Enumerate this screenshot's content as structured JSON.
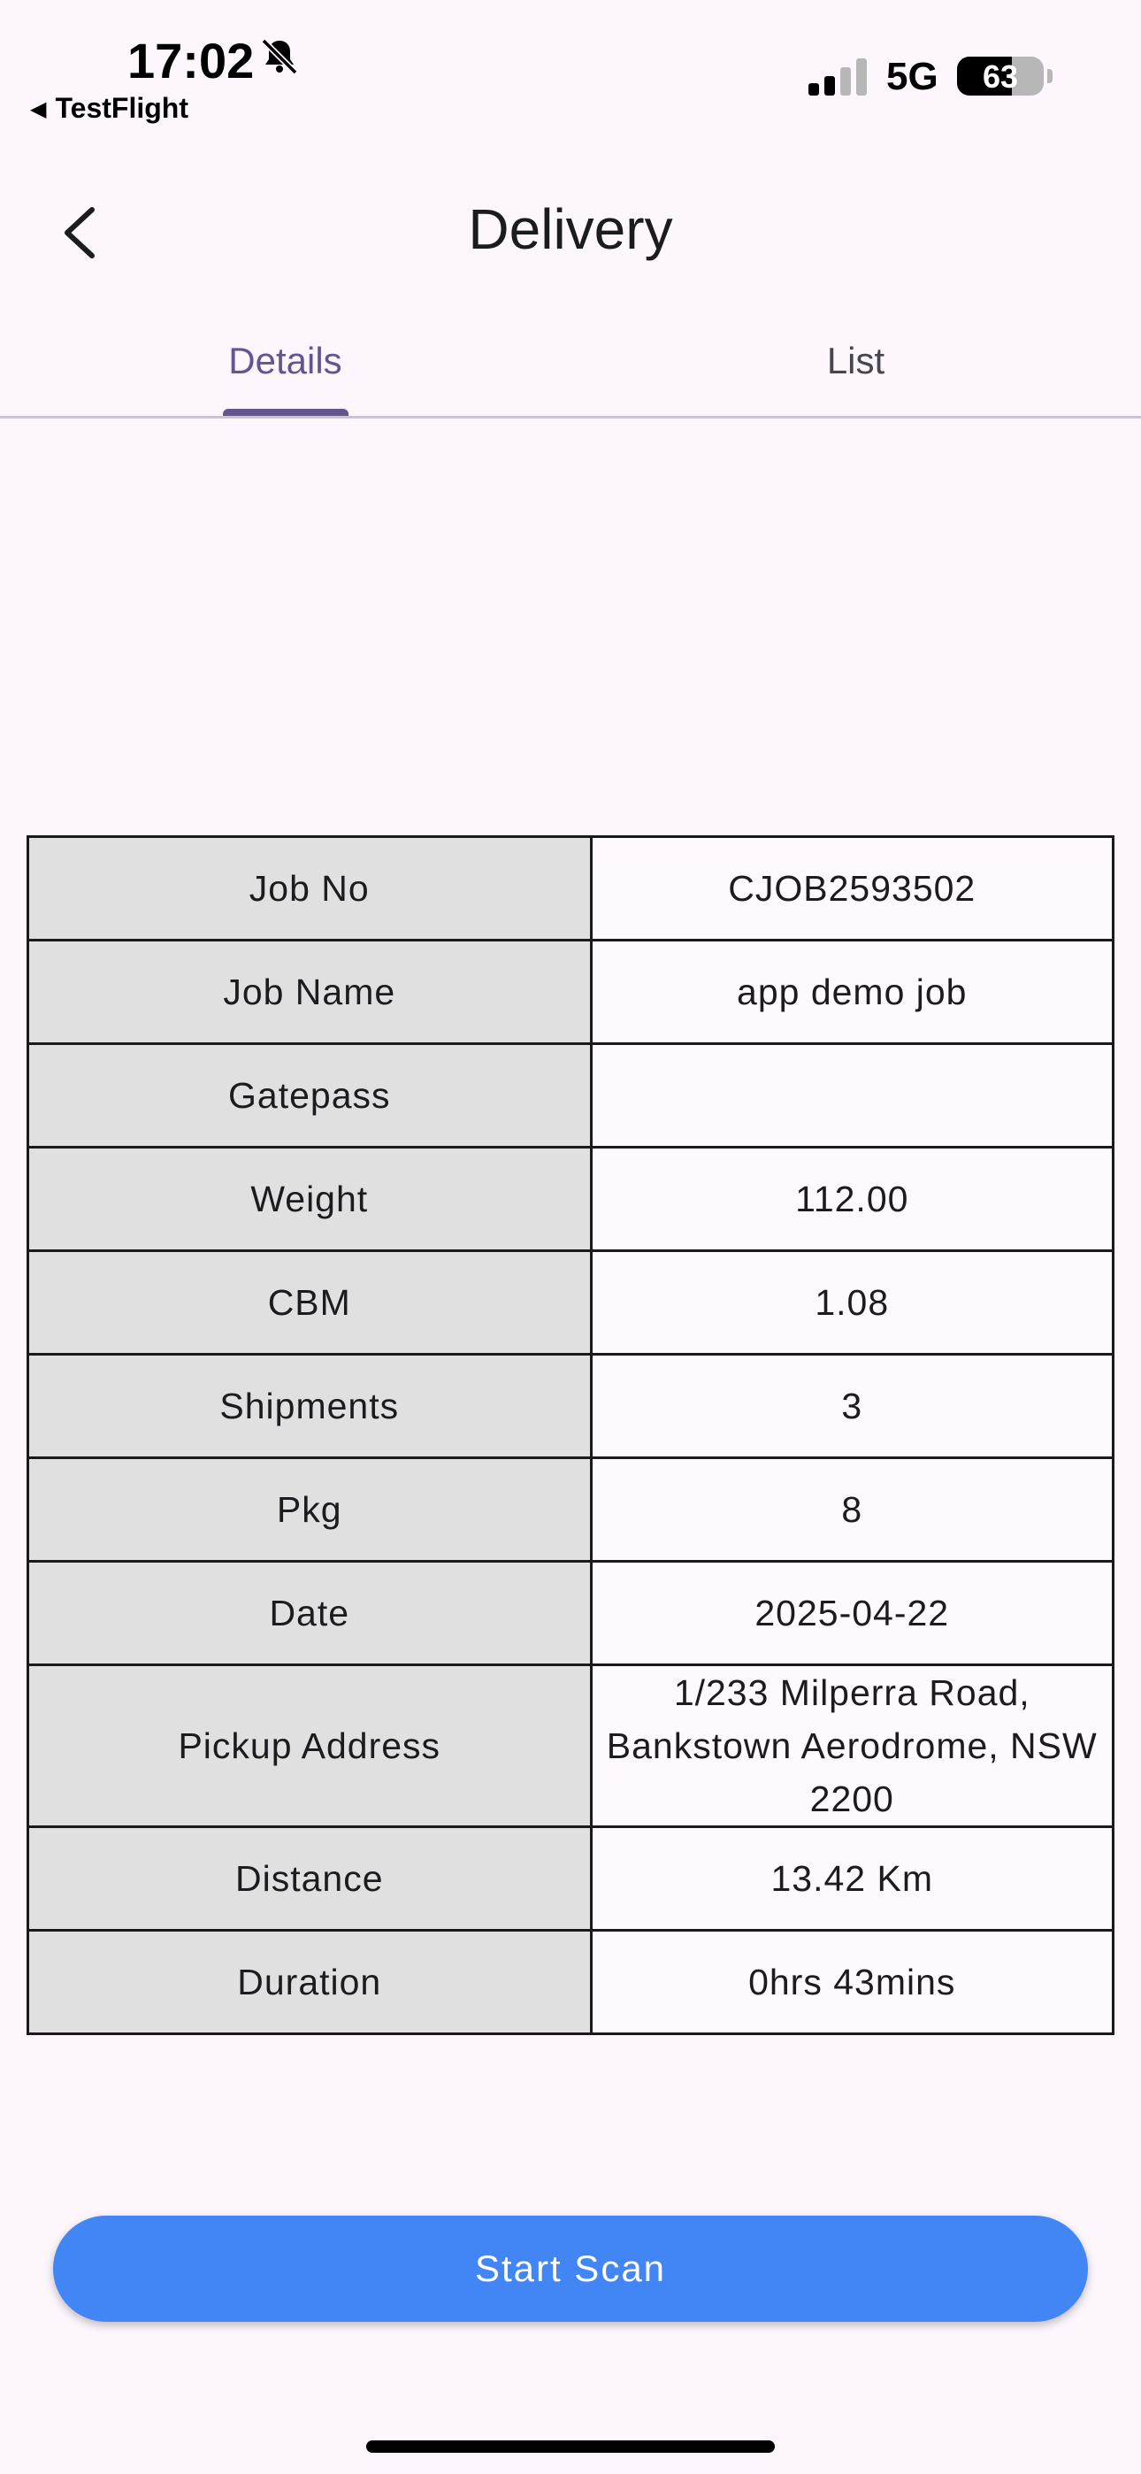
{
  "status_bar": {
    "time": "17:02",
    "back_app": "TestFlight",
    "network": "5G",
    "battery_percent": "63",
    "icons": [
      "bell-slash-icon",
      "signal-bars-icon",
      "battery-icon"
    ]
  },
  "app_bar": {
    "title": "Delivery",
    "back_icon": "chevron-left-icon"
  },
  "tabs": [
    {
      "label": "Details",
      "selected": true
    },
    {
      "label": "List",
      "selected": false
    }
  ],
  "details": {
    "rows": [
      {
        "label": "Job No",
        "value": "CJOB2593502"
      },
      {
        "label": "Job Name",
        "value": "app demo job"
      },
      {
        "label": "Gatepass",
        "value": ""
      },
      {
        "label": "Weight",
        "value": "112.00"
      },
      {
        "label": "CBM",
        "value": "1.08"
      },
      {
        "label": "Shipments",
        "value": "3"
      },
      {
        "label": "Pkg",
        "value": "8"
      },
      {
        "label": "Date",
        "value": "2025-04-22"
      },
      {
        "label": "Pickup Address",
        "value": "1/233 Milperra Road, Bankstown Aerodrome, NSW 2200"
      },
      {
        "label": "Distance",
        "value": "13.42 Km"
      },
      {
        "label": "Duration",
        "value": "0hrs 43mins"
      }
    ]
  },
  "actions": {
    "start_scan_label": "Start Scan"
  },
  "colors": {
    "background": "#fdf7fd",
    "accent": "#65558f",
    "button": "#4285f4",
    "label_cell": "#e0e0e0"
  }
}
